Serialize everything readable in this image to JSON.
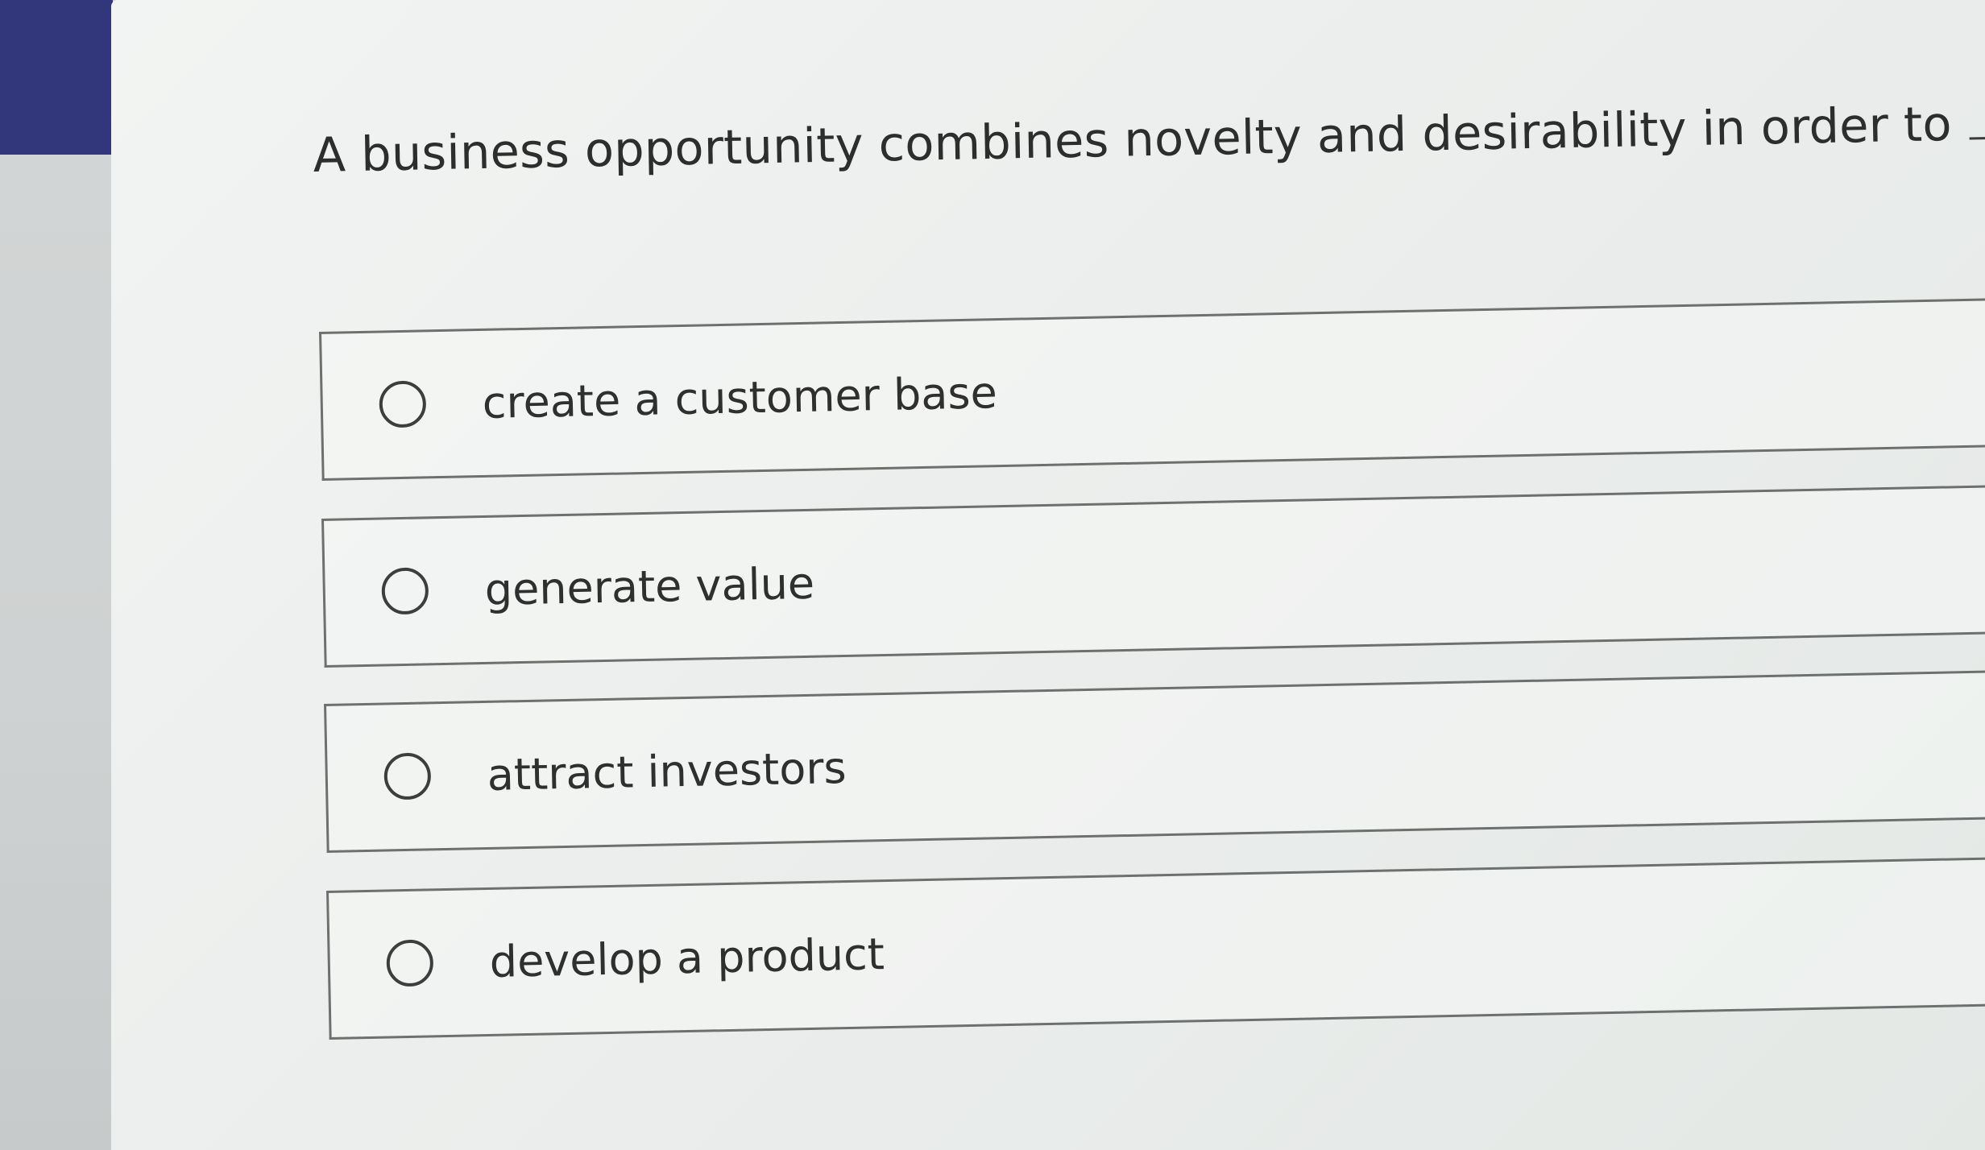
{
  "question": {
    "text": "A business opportunity combines novelty and desirability in order to",
    "end_punctuation": "."
  },
  "options": [
    {
      "label": "create a customer base"
    },
    {
      "label": "generate value"
    },
    {
      "label": "attract investors"
    },
    {
      "label": "develop a product"
    }
  ],
  "colors": {
    "nav_block": "#32367a",
    "content_bg": "#eceeed",
    "text": "#2d2d2d",
    "border": "#6e7070"
  }
}
